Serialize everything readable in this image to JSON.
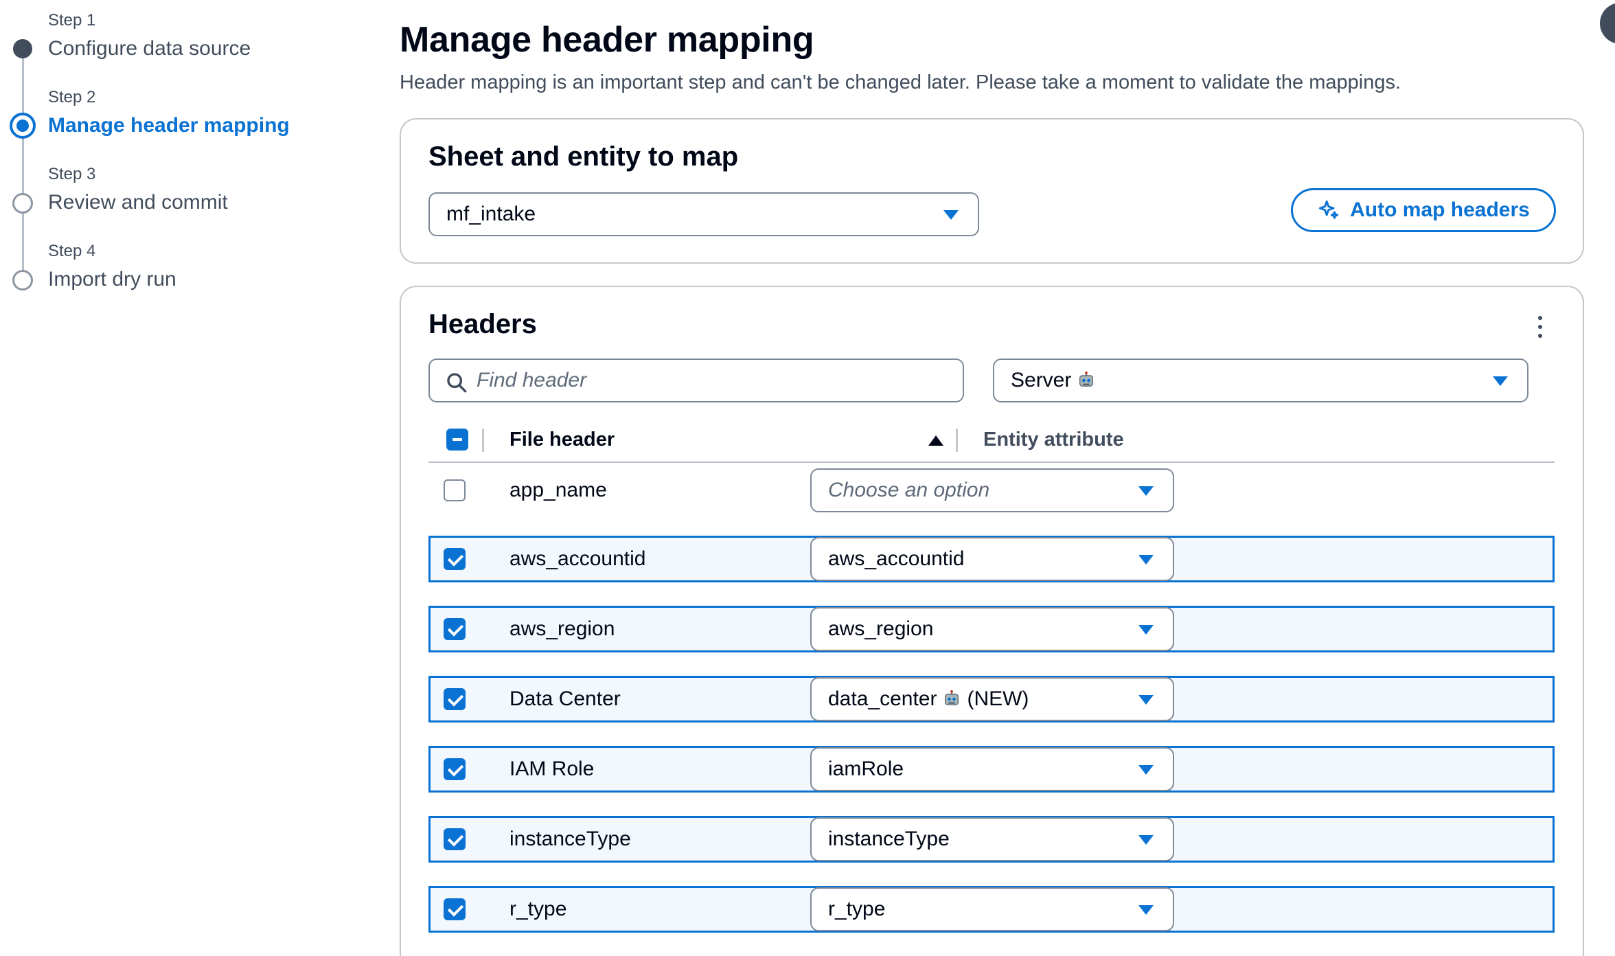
{
  "steps": [
    {
      "label": "Step 1",
      "title": "Configure data source",
      "state": "done"
    },
    {
      "label": "Step 2",
      "title": "Manage header mapping",
      "state": "active"
    },
    {
      "label": "Step 3",
      "title": "Review and commit",
      "state": "pending"
    },
    {
      "label": "Step 4",
      "title": "Import dry run",
      "state": "pending"
    }
  ],
  "page": {
    "title": "Manage header mapping",
    "description": "Header mapping is an important step and can't be changed later. Please take a moment to validate the mappings."
  },
  "sheet_panel": {
    "title": "Sheet and entity to map",
    "sheet_value": "mf_intake",
    "auto_map_label": "Auto map headers"
  },
  "headers_panel": {
    "title": "Headers",
    "search_placeholder": "Find header",
    "entity_value": "Server",
    "col_file_header": "File header",
    "col_entity_attribute": "Entity attribute",
    "rows": [
      {
        "file_header": "app_name",
        "attribute": "Choose an option",
        "placeholder": true,
        "checked": false
      },
      {
        "file_header": "aws_accountid",
        "attribute": "aws_accountid",
        "checked": true
      },
      {
        "file_header": "aws_region",
        "attribute": "aws_region",
        "checked": true
      },
      {
        "file_header": "Data Center",
        "attribute": "data_center",
        "attribute_suffix": "(NEW)",
        "robot": true,
        "checked": true
      },
      {
        "file_header": "IAM Role",
        "attribute": "iamRole",
        "checked": true
      },
      {
        "file_header": "instanceType",
        "attribute": "instanceType",
        "checked": true
      },
      {
        "file_header": "r_type",
        "attribute": "r_type",
        "checked": true
      }
    ]
  },
  "colors": {
    "accent": "#0972d3",
    "text": "#000716",
    "muted": "#414d5c",
    "border": "#c6c6cd",
    "selected_row_bg": "#f2f8fd"
  },
  "icons": [
    "search-icon",
    "sparkle-icon",
    "robot-icon",
    "more-vertical-icon",
    "sort-ascending-icon",
    "caret-down-icon"
  ]
}
